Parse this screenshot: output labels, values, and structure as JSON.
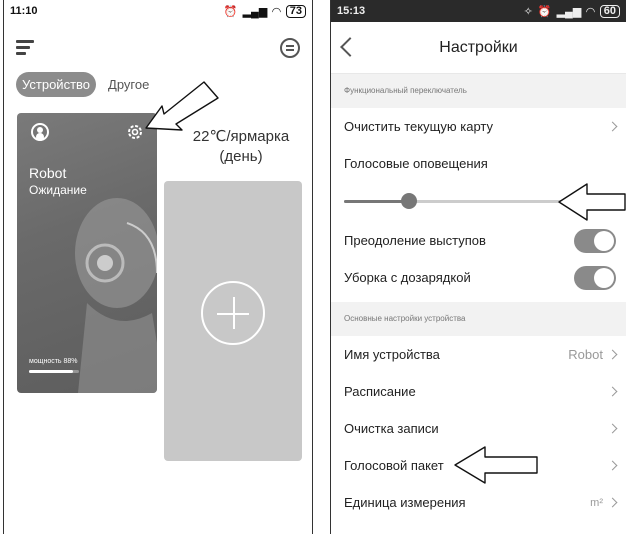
{
  "left_phone": {
    "status": {
      "time": "11:10",
      "icons": [
        "alarm-icon",
        "signal-icon",
        "wifi-icon"
      ],
      "battery": "73"
    },
    "tabs": [
      {
        "label": "Устройство",
        "active": true
      },
      {
        "label": "Другое",
        "active": false
      }
    ],
    "robot_card": {
      "name": "Robot",
      "status": "Ожидание",
      "power_label": "мощность 88%",
      "power_level": 0.88
    },
    "weather": {
      "line1": "22℃/ярмарка",
      "line2": "(день)"
    }
  },
  "right_phone": {
    "status": {
      "time": "15:13",
      "icons": [
        "vibrate-icon",
        "alarm-icon",
        "signal-icon",
        "wifi-icon"
      ],
      "battery": "60"
    },
    "title": "Настройки",
    "section1": {
      "header": "Функциональный переключатель",
      "clear_map": "Очистить текущую карту",
      "voice_alerts": "Голосовые оповещения",
      "volume_level": 0.27,
      "obstacle": "Преодоление выступов",
      "recharge": "Уборка с дозарядкой"
    },
    "section2": {
      "header": "Основные настройки устройства",
      "device_name": "Имя устройства",
      "device_name_value": "Robot",
      "schedule": "Расписание",
      "clean_log": "Очистка записи",
      "voice_pack": "Голосовой пакет",
      "units": "Единица измерения",
      "units_value": "m²"
    }
  }
}
